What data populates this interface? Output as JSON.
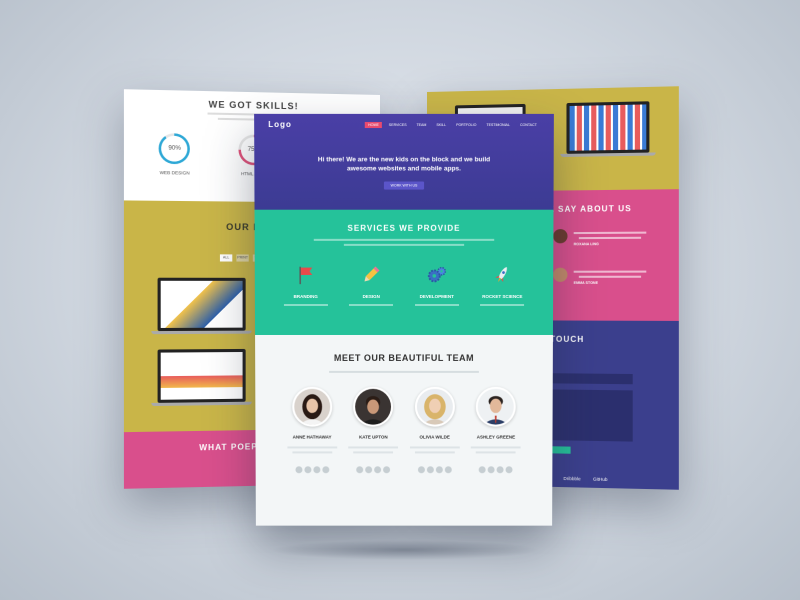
{
  "left_page": {
    "skills_title": "WE GOT SKILLS!",
    "skills": [
      {
        "label": "WEB DESIGN",
        "percent": "90%",
        "value": 90,
        "color": "#2ea8d6"
      },
      {
        "label": "HTML / CSS",
        "percent": "75%",
        "value": 75,
        "color": "#e0527a"
      }
    ],
    "portfolio_title": "OUR PORTF",
    "filters": [
      "ALL",
      "PRINT",
      "WEB"
    ],
    "people_title": "WHAT POEPLE"
  },
  "right_page": {
    "people_title": "PLE SAY ABOUT US",
    "testimonials": [
      {
        "name": "ROXANA LING"
      },
      {
        "name": "EMMA STONE"
      }
    ],
    "contact_title": "N TOUCH",
    "footer_links": [
      "Dribbble",
      "GitHub"
    ]
  },
  "center_page": {
    "logo": "Logo",
    "nav": [
      {
        "label": "HOME",
        "active": true
      },
      {
        "label": "SERVICES",
        "active": false
      },
      {
        "label": "TEAM",
        "active": false
      },
      {
        "label": "SKILL",
        "active": false
      },
      {
        "label": "PORTFOLIO",
        "active": false
      },
      {
        "label": "TESTIMONIAL",
        "active": false
      },
      {
        "label": "CONTACT",
        "active": false
      }
    ],
    "hero_text": "Hi there! We are the new kids on the block and we build awesome websites and mobile apps.",
    "hero_button": "WORK WITH US",
    "services_title": "SERVICES WE PROVIDE",
    "services": [
      {
        "title": "BRANDING",
        "icon": "flag-icon"
      },
      {
        "title": "DESIGN",
        "icon": "pencil-icon"
      },
      {
        "title": "DEVELOPMENT",
        "icon": "gears-icon"
      },
      {
        "title": "ROCKET SCIENCE",
        "icon": "rocket-icon"
      }
    ],
    "team_title": "MEET OUR BEAUTIFUL TEAM",
    "team": [
      {
        "name": "ANNE HATHAWAY",
        "skin": "#e8c4a8",
        "hair": "#2a1a14",
        "shirt": "#f4f4f4"
      },
      {
        "name": "KATE UPTON",
        "skin": "#c99878",
        "hair": "#2b1d16",
        "shirt": "#1d1d1d"
      },
      {
        "name": "OLIVIA WILDE",
        "skin": "#f0cfb4",
        "hair": "#d9b46a",
        "shirt": "#d8c9b8"
      },
      {
        "name": "ASHLEY GREENE",
        "skin": "#e2b89a",
        "hair": "#2b2320",
        "shirt": "#2c3e66"
      }
    ]
  }
}
